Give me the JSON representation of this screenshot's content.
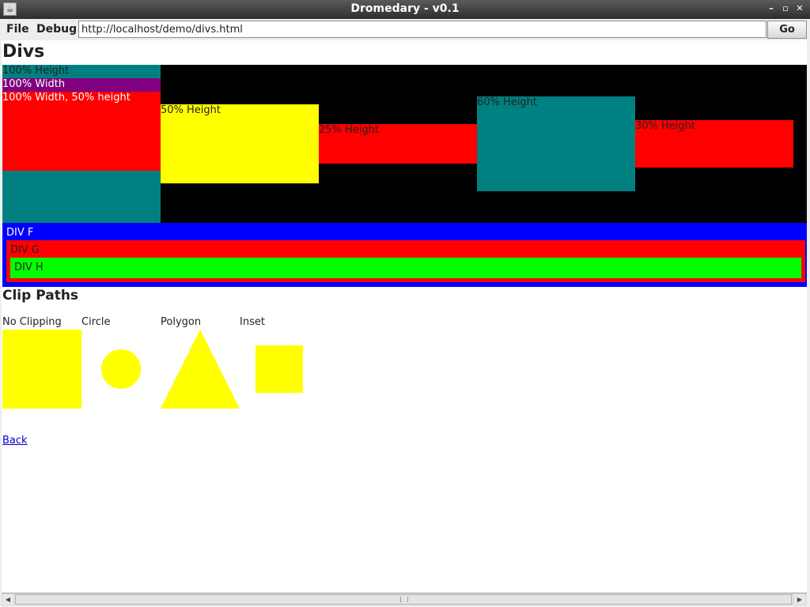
{
  "window": {
    "title": "Dromedary - v0.1",
    "min_label": "–",
    "max_label": "▫",
    "close_label": "✕"
  },
  "menubar": {
    "file": "File",
    "debug": "Debug"
  },
  "address": {
    "url": "http://localhost/demo/divs.html",
    "go_label": "Go"
  },
  "page": {
    "heading": "Divs",
    "blocks": {
      "h100": "100% Height",
      "w100": "100% Width",
      "w100h50": "100% Width, 50% height",
      "h50": "50% Height",
      "h25": "25% Height",
      "h60": "60% Height",
      "h30": "30% Height"
    },
    "nested": {
      "f": "DIV F",
      "g": "DIV G",
      "h": "DIV H"
    },
    "clip_heading": "Clip Paths",
    "clip_labels": {
      "none": "No Clipping",
      "circle": "Circle",
      "polygon": "Polygon",
      "inset": "Inset"
    },
    "back_link": "Back"
  },
  "colors": {
    "black": "#000000",
    "teal": "#008080",
    "purple": "#800080",
    "red": "#ff0000",
    "yellow": "#ffff00",
    "blue": "#0000ff",
    "lime": "#00ff00"
  }
}
